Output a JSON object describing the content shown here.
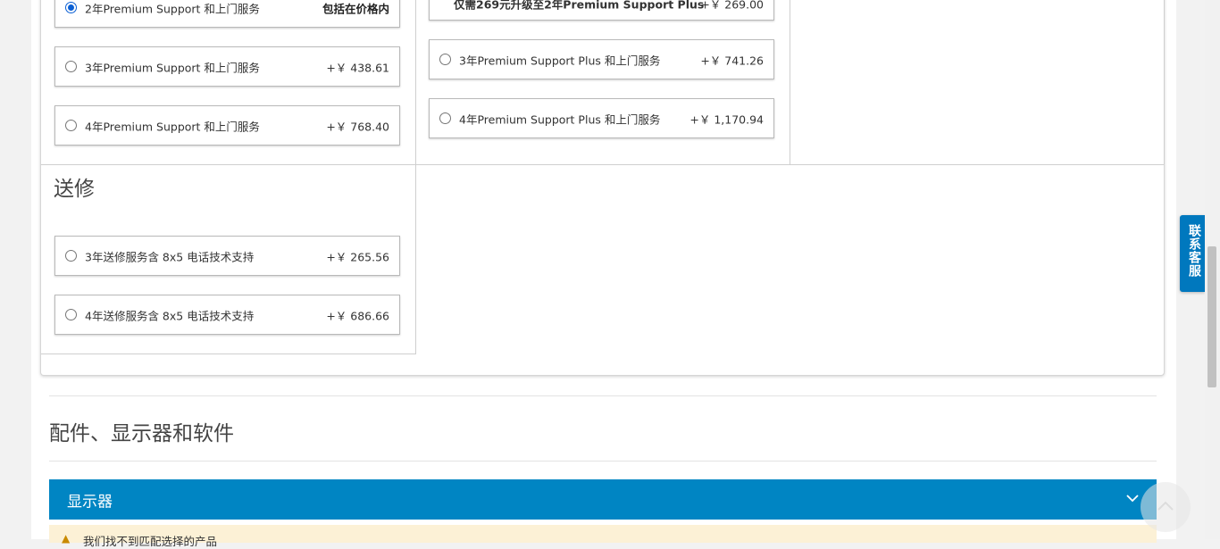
{
  "support": {
    "col1": [
      {
        "label": "2年Premium Support 和上门服务",
        "price": "包括在价格内",
        "selected": true
      },
      {
        "label": "3年Premium Support 和上门服务",
        "price": "+￥ 438.61",
        "selected": false
      },
      {
        "label": "4年Premium Support 和上门服务",
        "price": "+￥ 768.40",
        "selected": false
      }
    ],
    "col2_top": {
      "label": "仅需269元升级至2年Premium Support Plus",
      "price": "+￥ 269.00"
    },
    "col2": [
      {
        "label": "3年Premium Support Plus 和上门服务",
        "price": "+￥ 741.26",
        "selected": false
      },
      {
        "label": "4年Premium Support Plus 和上门服务",
        "price": "+￥ 1,170.94",
        "selected": false
      }
    ]
  },
  "repair": {
    "title": "送修",
    "options": [
      {
        "label": "3年送修服务含 8x5 电话技术支持",
        "price": "+￥ 265.56",
        "selected": false
      },
      {
        "label": "4年送修服务含 8x5 电话技术支持",
        "price": "+￥ 686.66",
        "selected": false
      }
    ]
  },
  "accessories": {
    "title": "配件、显示器和软件",
    "accordion_title": "显示器",
    "warning": "我们找不到匹配选择的产品"
  },
  "side_tab": {
    "label": "联系客服"
  },
  "colors": {
    "accent": "#0085c3",
    "orange": "#e05d1b",
    "radio": "#0a5fd4"
  }
}
